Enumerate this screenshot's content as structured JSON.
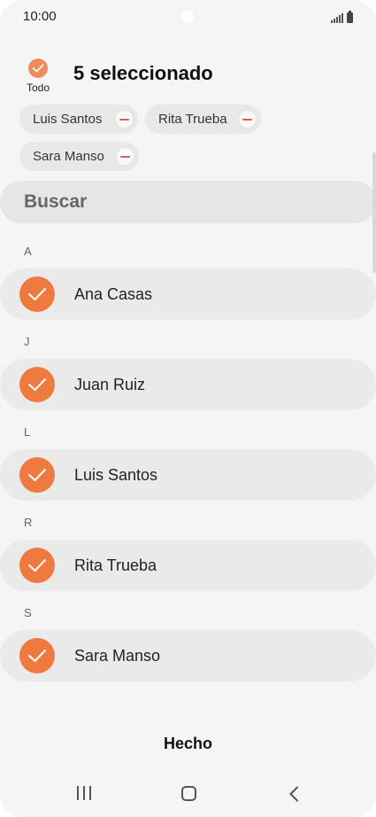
{
  "status_bar": {
    "time": "10:00",
    "icons": [
      "signal-icon",
      "battery-icon"
    ]
  },
  "header": {
    "select_all_label": "Todo",
    "selected_count_text": "5 seleccionado"
  },
  "chips": [
    {
      "label": "Luis Santos"
    },
    {
      "label": "Rita Trueba"
    },
    {
      "label": "Sara Manso"
    }
  ],
  "search": {
    "placeholder": "Buscar"
  },
  "sections": [
    {
      "letter": "A",
      "contacts": [
        {
          "name": "Ana Casas",
          "checked": true
        }
      ]
    },
    {
      "letter": "J",
      "contacts": [
        {
          "name": "Juan Ruiz",
          "checked": true
        }
      ]
    },
    {
      "letter": "L",
      "contacts": [
        {
          "name": "Luis Santos",
          "checked": true
        }
      ]
    },
    {
      "letter": "R",
      "contacts": [
        {
          "name": "Rita Trueba",
          "checked": true
        }
      ]
    },
    {
      "letter": "S",
      "contacts": [
        {
          "name": "Sara Manso",
          "checked": true
        }
      ]
    }
  ],
  "footer": {
    "done_label": "Hecho"
  },
  "colors": {
    "accent": "#EF7A3F",
    "chip_remove": "#E05A4F",
    "background": "#F5F5F5"
  },
  "nav_bar": {
    "icons": [
      "recents-icon",
      "home-icon",
      "back-icon"
    ]
  }
}
